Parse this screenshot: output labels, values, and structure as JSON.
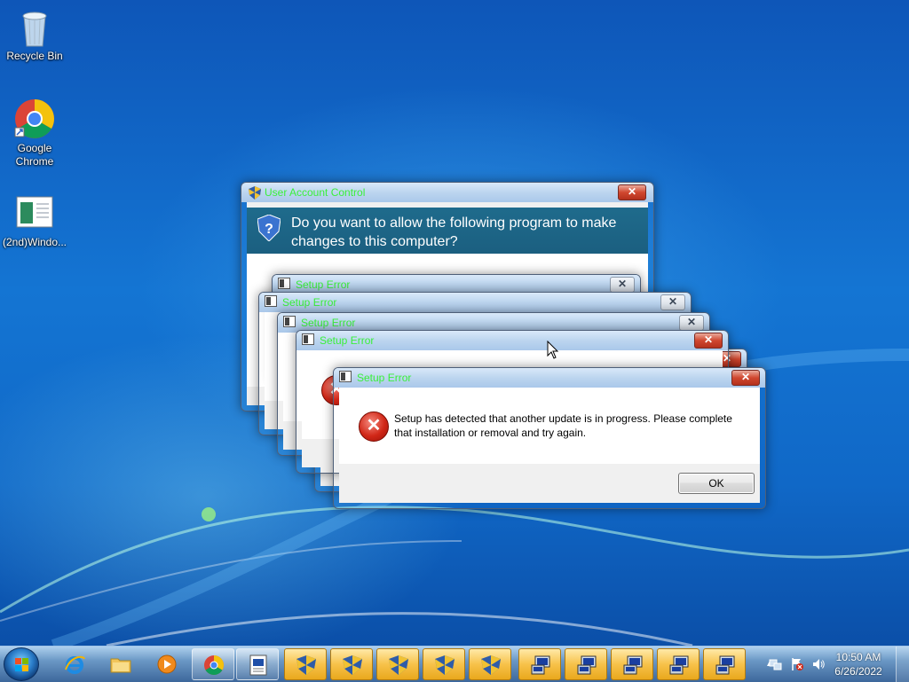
{
  "desktop": {
    "icons": [
      {
        "label": "Recycle Bin"
      },
      {
        "label": "Google Chrome"
      },
      {
        "label": "(2nd)Windo..."
      }
    ]
  },
  "uac": {
    "title": "User Account Control",
    "question": "Do you want to allow the following program to make changes to this computer?",
    "close": "✕"
  },
  "setup_errors": {
    "title": "Setup Error",
    "close": "✕",
    "message": "Setup has detected that another update is in progress.  Please complete that installation or removal and try again.",
    "ok_label": "OK"
  },
  "taskbar": {
    "pinned": [
      "start",
      "internet-explorer",
      "windows-explorer",
      "windows-media-player",
      "google-chrome",
      "setup-document"
    ],
    "uac_buttons": 5,
    "setup_buttons": 5,
    "clock": {
      "time": "10:50 AM",
      "date": "6/26/2022"
    },
    "tray_arrow": "▲"
  },
  "colors": {
    "desktop": "#1475d3",
    "uac_banner": "#1f6b8c",
    "title_text": "#3af03a",
    "close_red": "#d0472f"
  }
}
